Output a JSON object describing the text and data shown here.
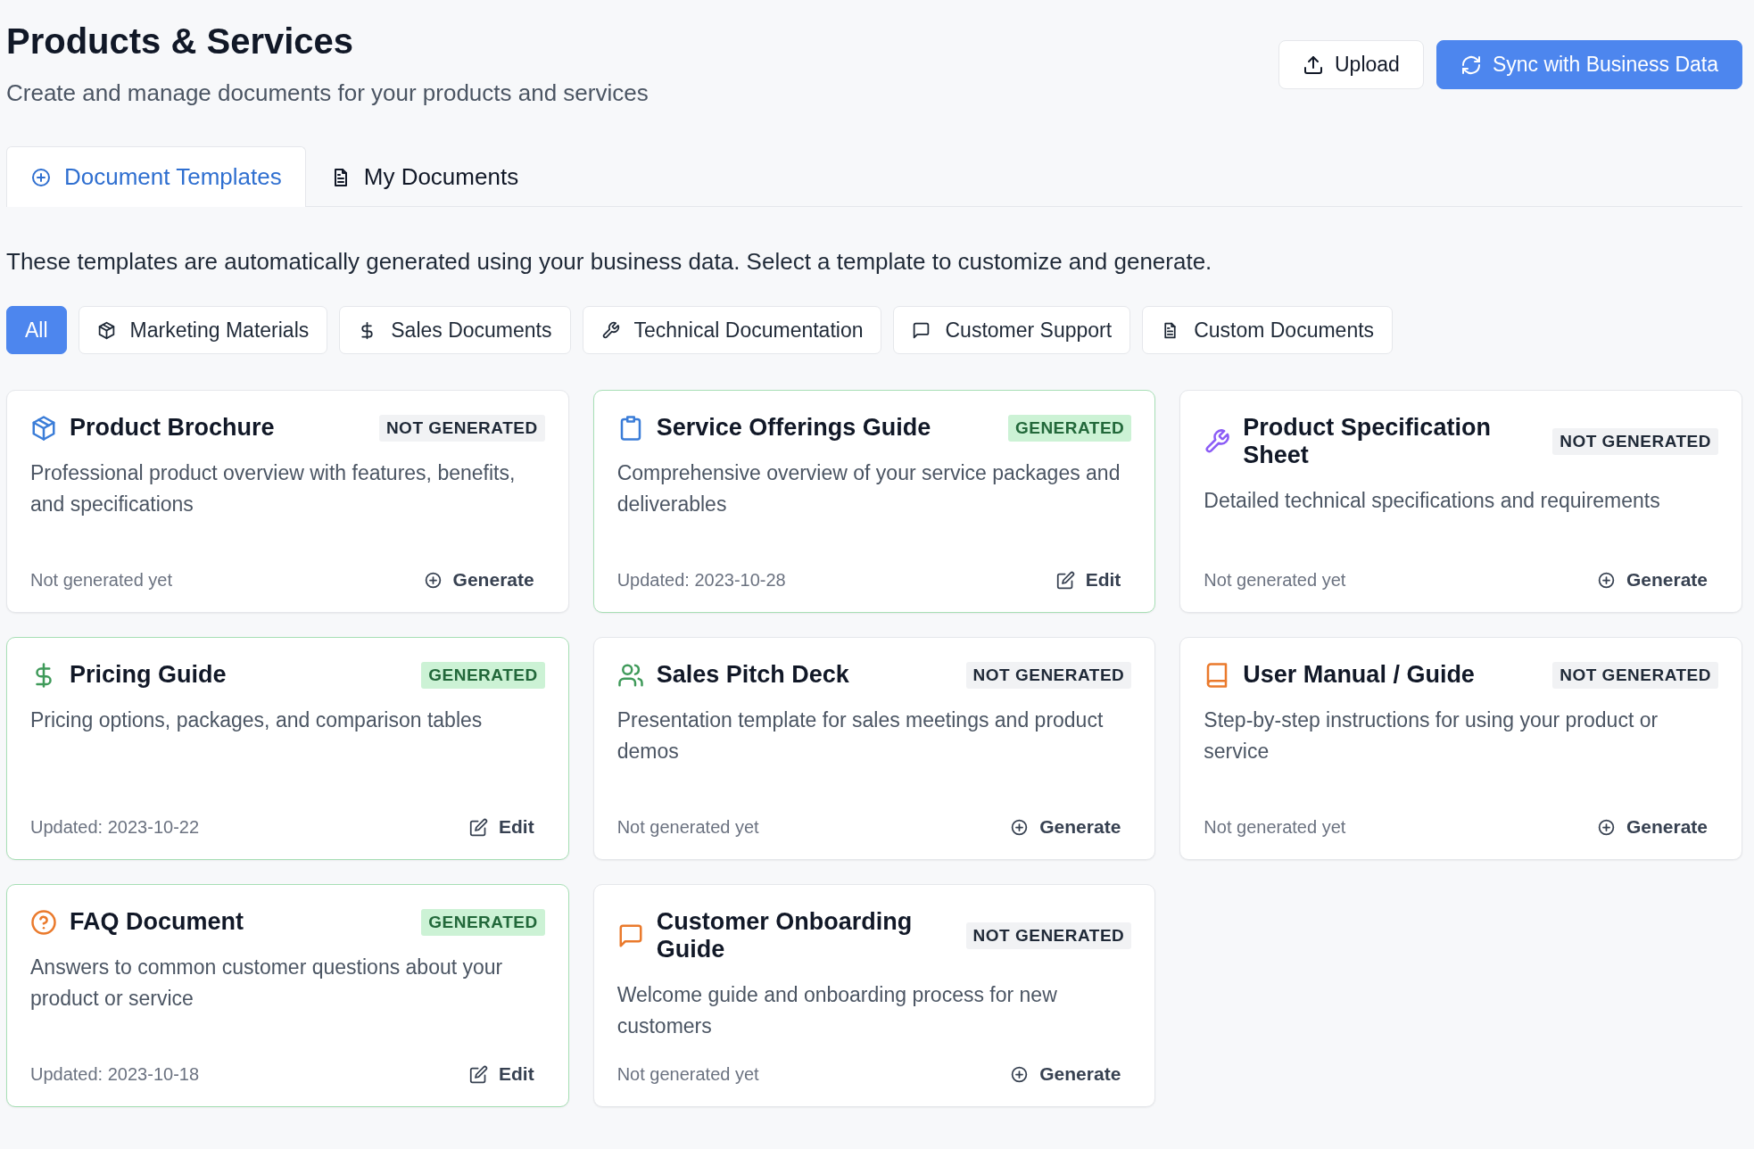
{
  "header": {
    "title": "Products & Services",
    "subtitle": "Create and manage documents for your products and services",
    "buttons": [
      {
        "label": "Upload",
        "kind": "upload"
      },
      {
        "label": "Sync with Business Data",
        "kind": "sync"
      }
    ]
  },
  "tabs": [
    {
      "label": "Document Templates",
      "selected": true
    },
    {
      "label": "My Documents",
      "selected": false
    }
  ],
  "intro": "These templates are automatically generated using your business data. Select a template to customize and generate.",
  "filters": [
    {
      "label": "All",
      "selected": true
    },
    {
      "label": "Marketing Materials",
      "selected": false
    },
    {
      "label": "Sales Documents",
      "selected": false
    },
    {
      "label": "Technical Documentation",
      "selected": false
    },
    {
      "label": "Customer Support",
      "selected": false
    },
    {
      "label": "Custom Documents",
      "selected": false
    }
  ],
  "cards": [
    {
      "title": "Product Brochure",
      "kind": "package",
      "color": "#3b7dd8",
      "status": "NOT GENERATED",
      "generated": false,
      "description": "Professional product overview with features, benefits, and specifications",
      "footer": "Not generated yet",
      "action": "Generate"
    },
    {
      "title": "Service Offerings Guide",
      "kind": "clipboard",
      "color": "#3b7dd8",
      "status": "GENERATED",
      "generated": true,
      "description": "Comprehensive overview of your service packages and deliverables",
      "footer": "Updated: 2023-10-28",
      "action": "Edit"
    },
    {
      "title": "Product Specification Sheet",
      "kind": "wrench",
      "color": "#8b5cf6",
      "status": "NOT GENERATED",
      "generated": false,
      "description": "Detailed technical specifications and requirements",
      "footer": "Not generated yet",
      "action": "Generate"
    },
    {
      "title": "Pricing Guide",
      "kind": "dollar",
      "color": "#3f9a5a",
      "status": "GENERATED",
      "generated": true,
      "description": "Pricing options, packages, and comparison tables",
      "footer": "Updated: 2023-10-22",
      "action": "Edit"
    },
    {
      "title": "Sales Pitch Deck",
      "kind": "users",
      "color": "#3f9a5a",
      "status": "NOT GENERATED",
      "generated": false,
      "description": "Presentation template for sales meetings and product demos",
      "footer": "Not generated yet",
      "action": "Generate"
    },
    {
      "title": "User Manual / Guide",
      "kind": "book",
      "color": "#ea7a2c",
      "status": "NOT GENERATED",
      "generated": false,
      "description": "Step-by-step instructions for using your product or service",
      "footer": "Not generated yet",
      "action": "Generate"
    },
    {
      "title": "FAQ Document",
      "kind": "help",
      "color": "#ea7a2c",
      "status": "GENERATED",
      "generated": true,
      "description": "Answers to common customer questions about your product or service",
      "footer": "Updated: 2023-10-18",
      "action": "Edit"
    },
    {
      "title": "Customer Onboarding Guide",
      "kind": "message",
      "color": "#ea7a2c",
      "status": "NOT GENERATED",
      "generated": false,
      "description": "Welcome guide and onboarding process for new customers",
      "footer": "Not generated yet",
      "action": "Generate"
    }
  ]
}
